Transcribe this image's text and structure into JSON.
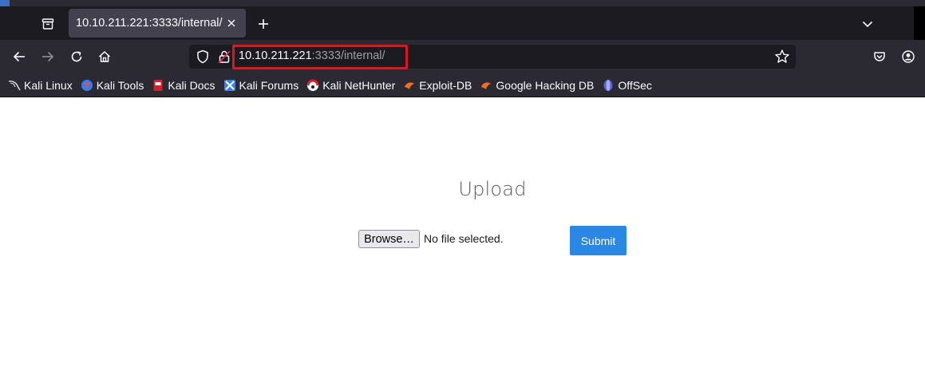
{
  "browser": {
    "tab": {
      "title": "10.10.211.221:3333/internal/"
    },
    "url": {
      "host": "10.10.211.221",
      "path": ":3333/internal/"
    },
    "icons": {
      "view_tabs": "firefox-view-icon",
      "close_tab": "close-icon",
      "new_tab": "plus-icon",
      "list_tabs": "chevron-down-icon",
      "back": "arrow-left-icon",
      "forward": "arrow-right-icon",
      "reload": "reload-icon",
      "home": "home-icon",
      "tracking": "shield-icon",
      "insecure": "lock-insecure-icon",
      "bookmark": "star-icon",
      "pocket": "pocket-icon",
      "account": "account-icon"
    },
    "colors": {
      "highlight": "#e0161f",
      "tab_active": "#42414d",
      "toolbar": "#2b2a33"
    }
  },
  "bookmarks": [
    {
      "label": "Kali Linux",
      "icon": "kali-dragon-icon"
    },
    {
      "label": "Kali Tools",
      "icon": "kali-tools-icon"
    },
    {
      "label": "Kali Docs",
      "icon": "kali-docs-icon"
    },
    {
      "label": "Kali Forums",
      "icon": "kali-forums-icon"
    },
    {
      "label": "Kali NetHunter",
      "icon": "kali-nethunter-icon"
    },
    {
      "label": "Exploit-DB",
      "icon": "exploit-db-icon"
    },
    {
      "label": "Google Hacking DB",
      "icon": "ghdb-icon"
    },
    {
      "label": "OffSec",
      "icon": "offsec-icon"
    }
  ],
  "page": {
    "heading": "Upload",
    "browse_label": "Browse…",
    "file_status": "No file selected.",
    "submit_label": "Submit",
    "colors": {
      "submit_bg": "#2a87e3"
    }
  }
}
